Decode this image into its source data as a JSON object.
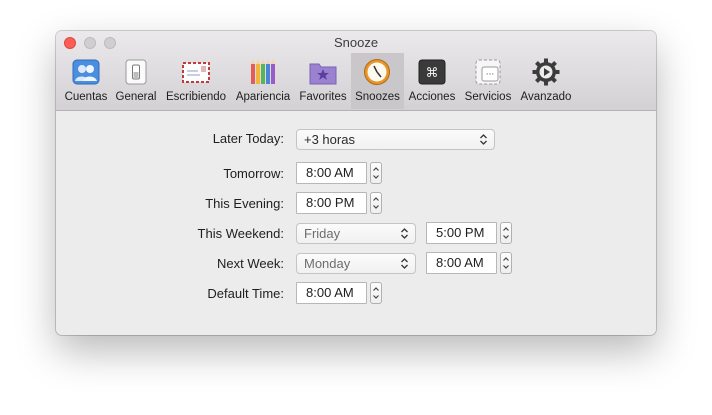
{
  "window": {
    "title": "Snooze"
  },
  "toolbar": {
    "tabs": [
      {
        "label": "Cuentas",
        "icon": "accounts-icon"
      },
      {
        "label": "General",
        "icon": "general-switch-icon"
      },
      {
        "label": "Escribiendo",
        "icon": "envelope-icon"
      },
      {
        "label": "Apariencia",
        "icon": "color-pencils-icon"
      },
      {
        "label": "Favorites",
        "icon": "star-folder-icon"
      },
      {
        "label": "Snoozes",
        "icon": "clock-icon",
        "selected": true
      },
      {
        "label": "Acciones",
        "icon": "command-key-icon"
      },
      {
        "label": "Servicios",
        "icon": "services-icon"
      },
      {
        "label": "Avanzado",
        "icon": "advanced-gear-icon"
      }
    ]
  },
  "form": {
    "later_today": {
      "label": "Later Today:",
      "value": "+3 horas"
    },
    "tomorrow": {
      "label": "Tomorrow:",
      "time": "8:00 AM"
    },
    "this_evening": {
      "label": "This Evening:",
      "time": "8:00 PM"
    },
    "this_weekend": {
      "label": "This Weekend:",
      "day": "Friday",
      "time": "5:00 PM"
    },
    "next_week": {
      "label": "Next Week:",
      "day": "Monday",
      "time": "8:00 AM"
    },
    "default_time": {
      "label": "Default Time:",
      "time": "8:00 AM"
    }
  },
  "colors": {
    "close": "#fc5f57",
    "window_bg": "#ececec",
    "selected_tab": "#c9c7c9"
  }
}
